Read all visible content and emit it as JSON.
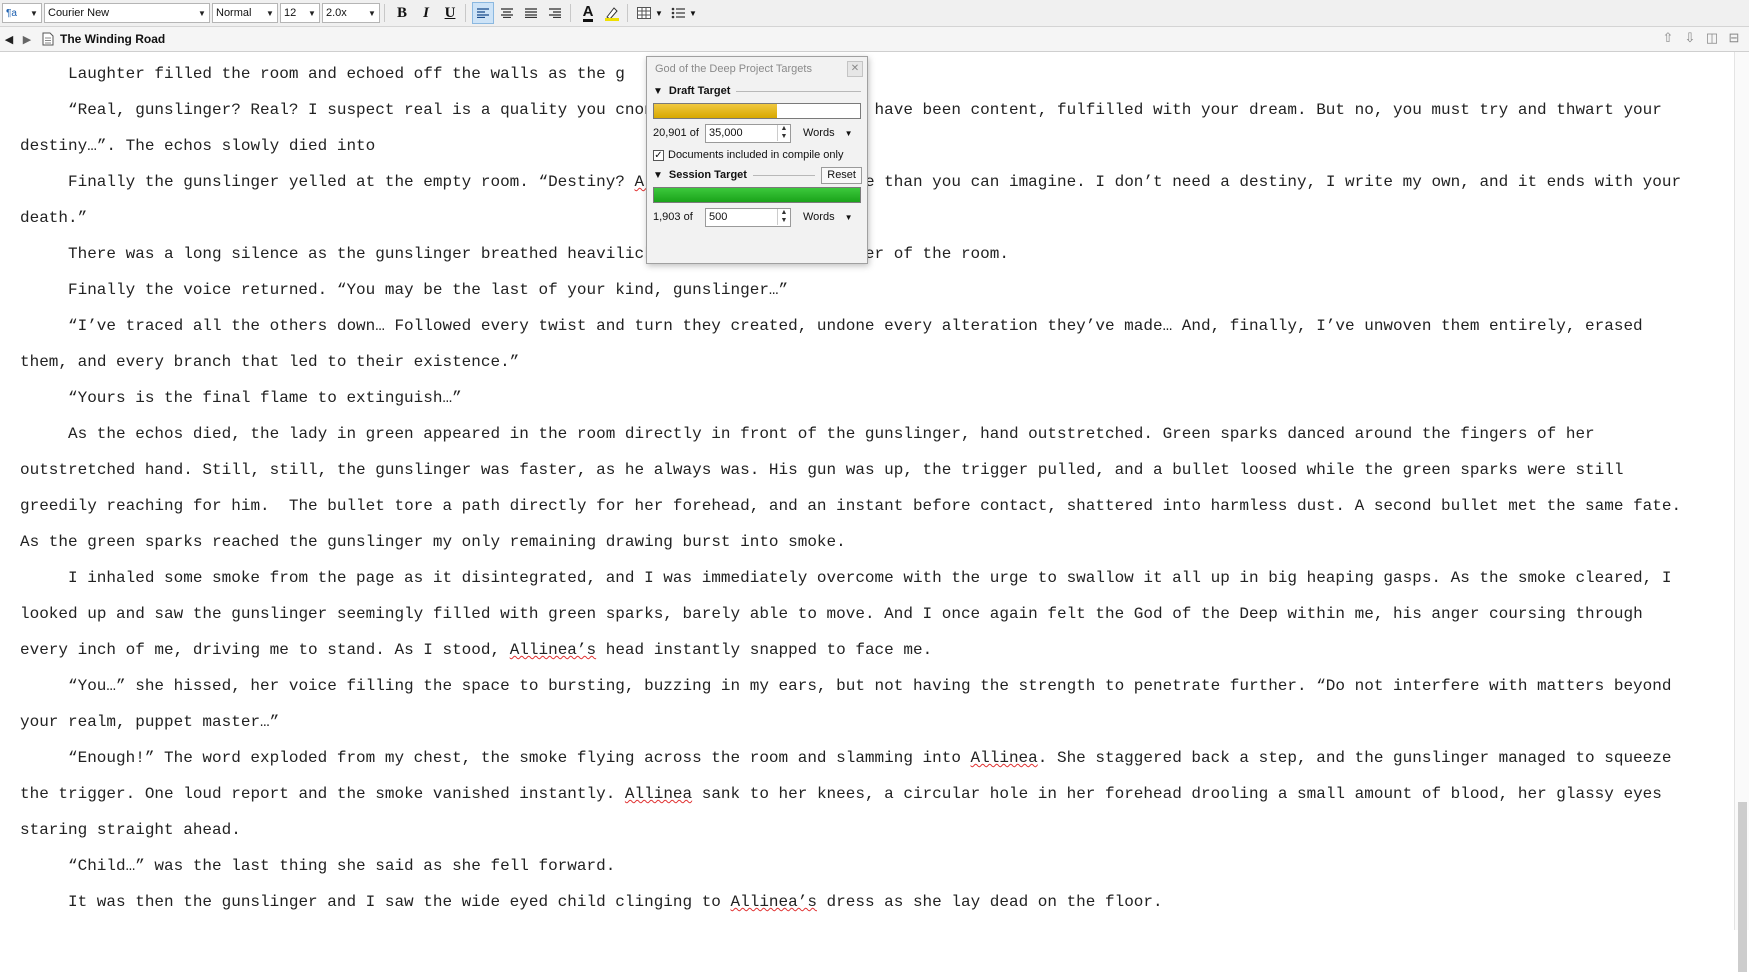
{
  "toolbar": {
    "style_label": "¶a",
    "font_family": "Courier New",
    "paragraph_style": "Normal",
    "font_size": "12",
    "line_spacing": "2.0x",
    "bold_label": "B",
    "italic_label": "I",
    "underline_label": "U",
    "text_color_label": "A"
  },
  "header": {
    "document_title": "The Winding Road"
  },
  "targets_panel": {
    "title": "God of the Deep Project Targets",
    "draft_target": {
      "label": "Draft Target",
      "count": "20,901 of",
      "target": "35,000",
      "unit": "Words",
      "progress": 0.597,
      "color": "#d8a800"
    },
    "compile_only_label": "Documents included in compile only",
    "compile_only_checked": true,
    "session_target": {
      "label": "Session Target",
      "reset_label": "Reset",
      "count": "1,903 of",
      "target": "500",
      "unit": "Words",
      "progress": 1.0,
      "color": "#1aa31a"
    }
  },
  "document": {
    "paragraphs": [
      [
        "Laughter filled the room and echoed off the walls as the g"
      ],
      [
        "“Real, gunslinger? Real? I suspect real is a quality you c",
        "none of us can. You could have been content, fulfilled with your dream. But no, you must try and thwart your destiny…”. The echos slowly died into"
      ],
      [
        "Finally the gunslinger yelled at the empty room. “Destiny?",
        " ",
        {
          "sp": "Allinea"
        },
        "? Yes, I know more than you can imagine. I don’t need a destiny, I write my own, and it ends with your death.”"
      ],
      [
        "There was a long silence as the gunslinger breathed heavil",
        "ickly to watch every corner of the room."
      ],
      [
        "Finally the voice returned. “You may be the last of your kind, gunslinger…”"
      ],
      [
        "“I’ve traced all the others down… Followed every twist and turn they created, undone every alteration they’ve made… And, finally, I’ve unwoven them entirely, erased them, and every branch that led to their existence.”"
      ],
      [
        "“Yours is the final flame to extinguish…”"
      ],
      [
        "As the echos died, the lady in green appeared in the room directly in front of the gunslinger, hand outstretched. Green sparks danced around the fingers of her outstretched hand. Still, still, the gunslinger was faster, as he always was. His gun was up, the trigger pulled, and a bullet loosed while the green sparks were still greedily reaching for him.  The bullet tore a path directly for her forehead, and an instant before contact, shattered into harmless dust. A second bullet met the same fate. As the green sparks reached the gunslinger my only remaining drawing burst into smoke."
      ],
      [
        "I inhaled some smoke from the page as it disintegrated, and I was immediately overcome with the urge to swallow it all up in big heaping gasps. As the smoke cleared, I looked up and saw the gunslinger seemingly filled with green sparks, barely able to move. And I once again felt the God of the Deep within me, his anger coursing through every inch of me, driving me to stand. As I stood, ",
        {
          "sp": "Allinea’s"
        },
        " head instantly snapped to face me."
      ],
      [
        "“You…” she hissed, her voice filling the space to bursting, buzzing in my ears, but not having the strength to penetrate further. “Do not interfere with matters beyond your realm, puppet master…”"
      ],
      [
        "“Enough!” The word exploded from my chest, the smoke flying across the room and slamming into ",
        {
          "sp": "Allinea"
        },
        ". She staggered back a step, and the gunslinger managed to squeeze the trigger. One loud report and the smoke vanished instantly. ",
        {
          "sp": "Allinea"
        },
        " sank to her knees, a circular hole in her forehead drooling a small amount of blood, her glassy eyes staring straight ahead."
      ],
      [
        "“Child…” was the last thing she said as she fell forward."
      ],
      [
        "It was then the gunslinger and I saw the wide eyed child clinging to ",
        {
          "sp": "Allinea’s"
        },
        " dress as she lay dead on the floor."
      ]
    ]
  }
}
